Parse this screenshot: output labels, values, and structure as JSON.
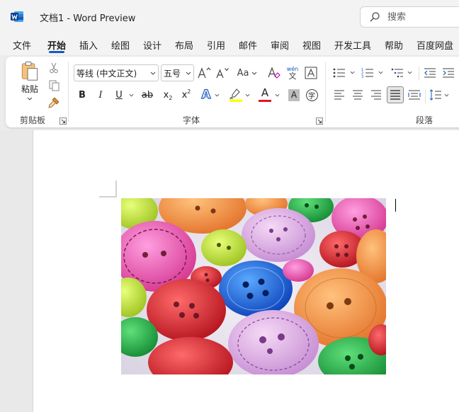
{
  "titlebar": {
    "doc_title": "文档1  -  Word Preview",
    "search_placeholder": "搜索"
  },
  "tabs": [
    {
      "label": "文件"
    },
    {
      "label": "开始"
    },
    {
      "label": "插入"
    },
    {
      "label": "绘图"
    },
    {
      "label": "设计"
    },
    {
      "label": "布局"
    },
    {
      "label": "引用"
    },
    {
      "label": "邮件"
    },
    {
      "label": "审阅"
    },
    {
      "label": "视图"
    },
    {
      "label": "开发工具"
    },
    {
      "label": "帮助"
    },
    {
      "label": "百度网盘"
    }
  ],
  "active_tab": "开始",
  "ribbon": {
    "clipboard": {
      "paste_label": "粘贴",
      "group_label": "剪贴板"
    },
    "font": {
      "font_name": "等线 (中文正文)",
      "font_size": "五号",
      "change_case_label": "Aa",
      "phonetic_top": "wén",
      "phonetic_bottom": "文",
      "bold": "B",
      "italic": "I",
      "underline": "U",
      "strike": "ab",
      "subscript": "x",
      "subscript_mark": "2",
      "superscript": "x",
      "superscript_mark": "2",
      "effects_glyph": "A",
      "font_color_glyph": "A",
      "char_shading_glyph": "A",
      "enclose_glyph": "字",
      "group_label": "字体"
    },
    "paragraph": {
      "group_label": "段落"
    }
  },
  "colors": {
    "accent": "#185abd",
    "highlight_yellow": "#ffff00",
    "font_color_red": "#e81123"
  }
}
